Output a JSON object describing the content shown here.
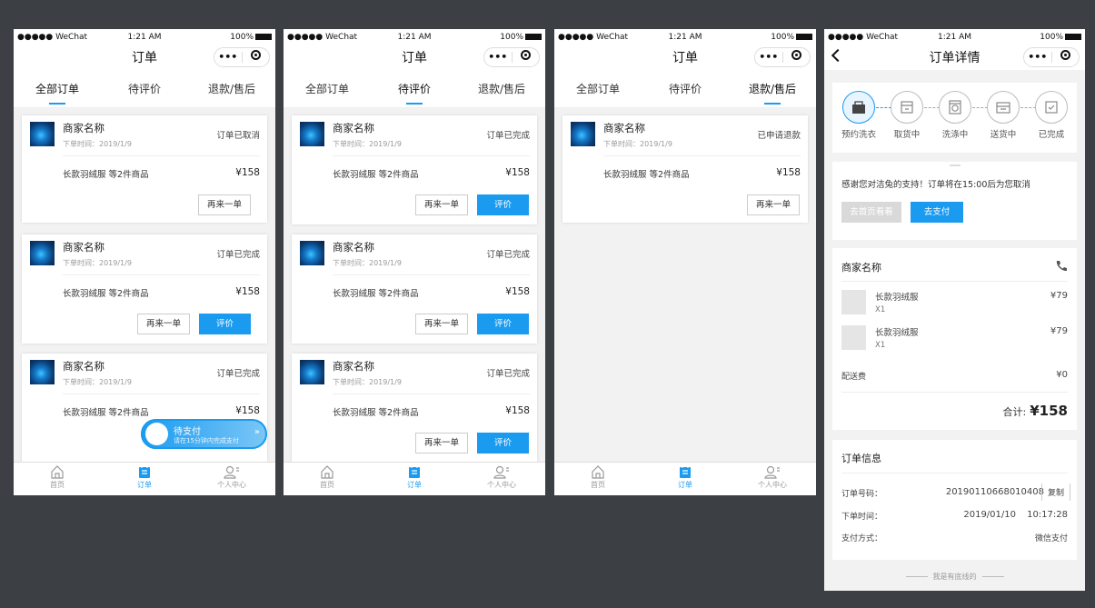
{
  "status": {
    "carrier": "●●●●● WeChat",
    "time": "1:21 AM",
    "battery": "100%"
  },
  "title_orders": "订单",
  "title_detail": "订单详情",
  "tabs": [
    "全部订单",
    "待评价",
    "退款/售后"
  ],
  "merchant": "商家名称",
  "order_time": "下单时间：2019/1/9",
  "goods": "长款羽绒服 等2件商品",
  "price": "¥158",
  "btn_again": "再来一单",
  "btn_review": "评价",
  "statuses": {
    "cancelled": "订单已取消",
    "done": "订单已完成",
    "refund": "已申请退款"
  },
  "nav": {
    "home": "首页",
    "order": "订单",
    "me": "个人中心"
  },
  "float_pay": {
    "title": "待支付",
    "sub": "请在15分钟内完成支付",
    "arrow": "»"
  },
  "steps": [
    "预约洗衣",
    "取货中",
    "洗涤中",
    "送货中",
    "已完成"
  ],
  "notice": {
    "text": "感谢您对洁兔的支持！订单将在15:00后为您取消",
    "btn_home": "去首页看看",
    "btn_pay": "去支付"
  },
  "detail": {
    "merchant": "商家名称",
    "items": [
      {
        "name": "长款羽绒服",
        "qty": "X1",
        "price": "¥79"
      },
      {
        "name": "长款羽绒服",
        "qty": "X1",
        "price": "¥79"
      }
    ],
    "delivery_label": "配送费",
    "delivery_value": "¥0",
    "total_label": "合计:",
    "total_value": "¥158",
    "info_title": "订单信息",
    "order_no_label": "订单号码：",
    "order_no": "20190110668010408",
    "copy": "复制",
    "time_label": "下单时间：",
    "time_date": "2019/01/10",
    "time_clock": "10:17:28",
    "pay_label": "支付方式：",
    "pay_value": "微信支付",
    "footer": "我是有底线的"
  },
  "colors": {
    "accent": "#1a9bf0",
    "bg": "#3c3f43"
  }
}
